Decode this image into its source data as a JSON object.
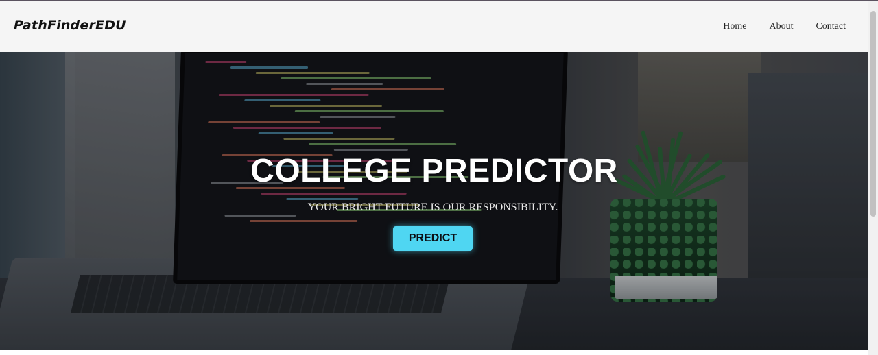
{
  "brand": {
    "name": "PathFinderEDU"
  },
  "nav": {
    "links": [
      {
        "label": "Home"
      },
      {
        "label": "About"
      },
      {
        "label": "Contact"
      }
    ]
  },
  "hero": {
    "title": "COLLEGE PREDICTOR",
    "subtitle": "YOUR BRIGHT FUTURE IS OUR RESPONSIBILITY.",
    "cta_label": "PREDICT"
  },
  "colors": {
    "navbar_bg": "#f5f5f5",
    "cta_bg": "#4fd6f2",
    "title_text": "#ffffff"
  }
}
